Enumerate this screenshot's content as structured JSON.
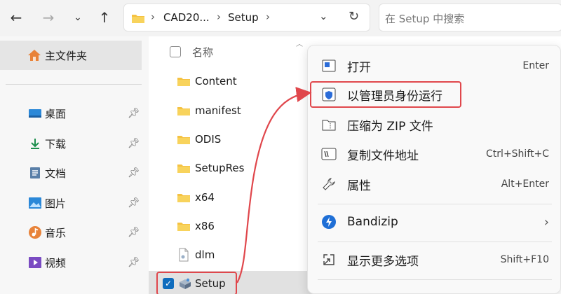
{
  "nav": {
    "address": {
      "segment_1": "CAD20...",
      "segment_2": "Setup"
    },
    "search": {
      "placeholder": "在 Setup 中搜索"
    }
  },
  "sidebar": {
    "home_label": "主文件夹",
    "quick_access": [
      {
        "label": "桌面",
        "icon": "desktop-icon"
      },
      {
        "label": "下载",
        "icon": "download-icon"
      },
      {
        "label": "文档",
        "icon": "document-icon"
      },
      {
        "label": "图片",
        "icon": "pictures-icon"
      },
      {
        "label": "音乐",
        "icon": "music-icon"
      },
      {
        "label": "视频",
        "icon": "video-icon"
      }
    ]
  },
  "file_list": {
    "column_header": "名称",
    "items": [
      {
        "name": "Content",
        "type": "folder"
      },
      {
        "name": "manifest",
        "type": "folder"
      },
      {
        "name": "ODIS",
        "type": "folder"
      },
      {
        "name": "SetupRes",
        "type": "folder"
      },
      {
        "name": "x64",
        "type": "folder"
      },
      {
        "name": "x86",
        "type": "folder"
      },
      {
        "name": "dlm",
        "type": "file"
      },
      {
        "name": "Setup",
        "type": "application",
        "selected": true
      }
    ]
  },
  "context_menu": {
    "items": [
      {
        "label": "打开",
        "shortcut": "Enter",
        "icon": "open-icon"
      },
      {
        "label": "以管理员身份运行",
        "shortcut": "",
        "icon": "shield-icon",
        "highlighted": true
      },
      {
        "label": "压缩为 ZIP 文件",
        "shortcut": "",
        "icon": "zip-icon"
      },
      {
        "label": "复制文件地址",
        "shortcut": "Ctrl+Shift+C",
        "icon": "copy-path-icon"
      },
      {
        "label": "属性",
        "shortcut": "Alt+Enter",
        "icon": "wrench-icon"
      },
      {
        "label": "Bandizip",
        "shortcut": "",
        "icon": "bandizip-icon",
        "submenu": true
      },
      {
        "label": "显示更多选项",
        "shortcut": "Shift+F10",
        "icon": "more-options-icon"
      }
    ]
  },
  "colors": {
    "highlight_border": "#e0474c",
    "accent": "#0f6cbd",
    "folder": "#f5c242"
  }
}
